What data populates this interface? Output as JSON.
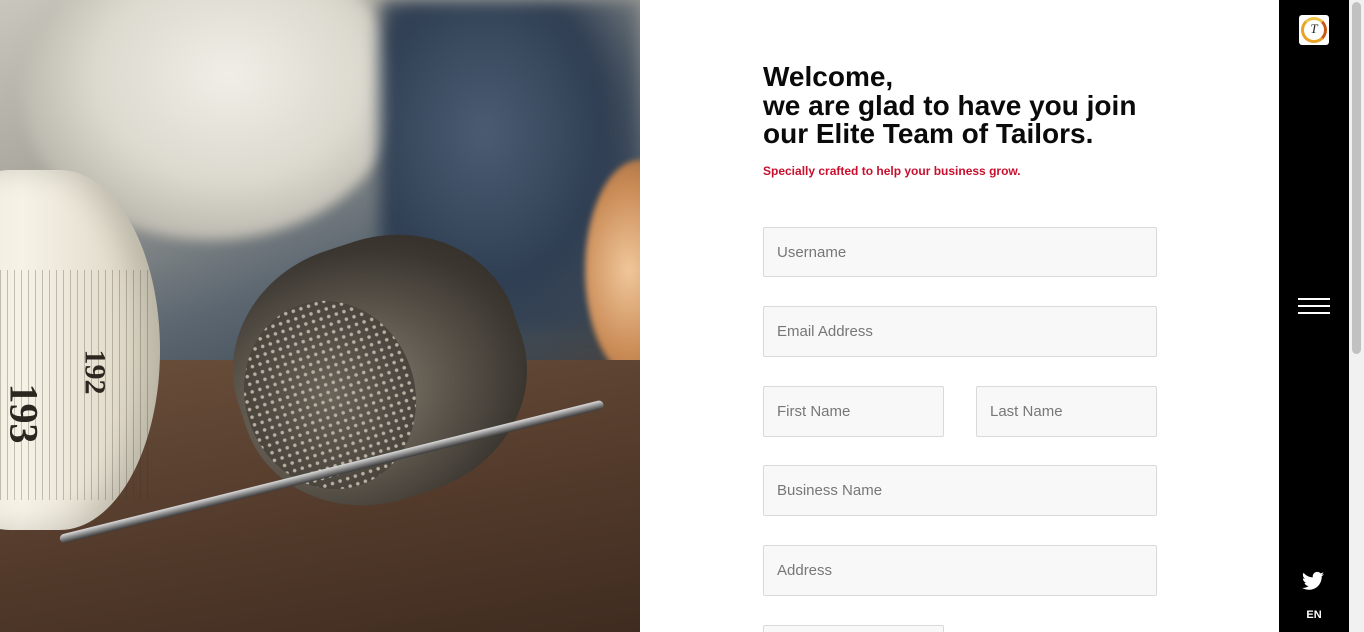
{
  "hero": {
    "tape_numbers": [
      "193",
      "192"
    ]
  },
  "form": {
    "heading": "Welcome,\nwe are glad to have you join\nour Elite Team of Tailors.",
    "tagline": "Specially crafted to help your business grow.",
    "fields": {
      "username": "Username",
      "email": "Email Address",
      "first_name": "First Name",
      "last_name": "Last Name",
      "business_name": "Business Name",
      "address": "Address"
    }
  },
  "rail": {
    "logo_letter": "T",
    "menu_icon": "hamburger-icon",
    "social_icon": "twitter-icon",
    "language": "EN"
  },
  "colors": {
    "accent": "#c8102e",
    "rail_bg": "#000000",
    "heading": "#0a0a0a"
  }
}
